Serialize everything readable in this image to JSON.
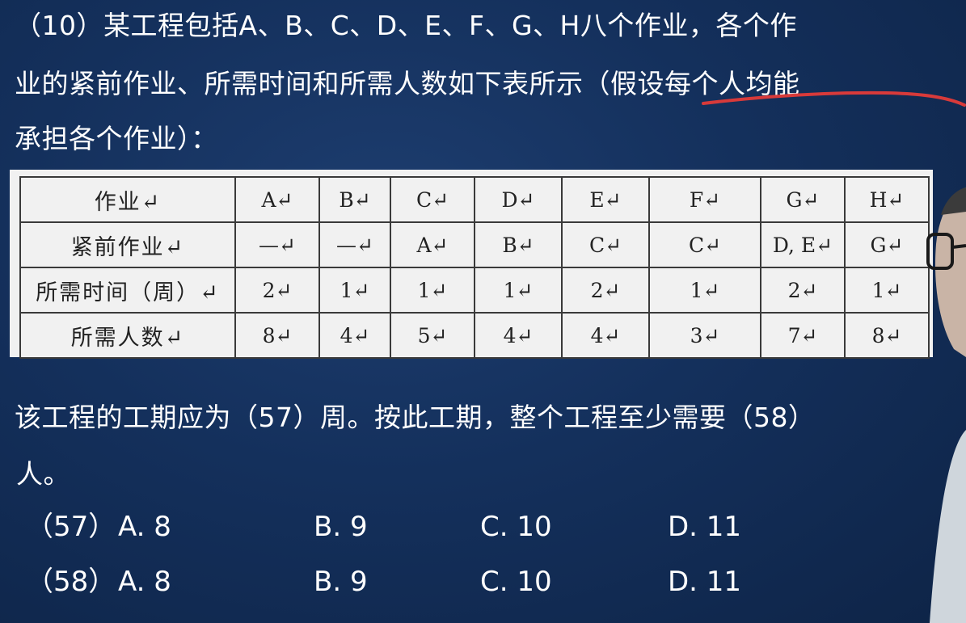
{
  "question": {
    "line1": "（10）某工程包括A、B、C、D、E、F、G、H八个作业，各个作",
    "line2": "业的紧前作业、所需时间和所需人数如下表所示（假设每个人均能",
    "line3": "承担各个作业）：",
    "line4": "该工程的工期应为（57）周。按此工期，整个工程至少需要（58）",
    "line5": "人。"
  },
  "table": {
    "header_label": "作业↵",
    "columns": [
      "A↵",
      "B↵",
      "C↵",
      "D↵",
      "E↵",
      "F↵",
      "G↵",
      "H↵"
    ],
    "rows": [
      {
        "label": "紧前作业↵",
        "values": [
          "—↵",
          "—↵",
          "A↵",
          "B↵",
          "C↵",
          "C↵",
          "D, E↵",
          "G↵"
        ]
      },
      {
        "label": "所需时间（周）↵",
        "values": [
          "2↵",
          "1↵",
          "1↵",
          "1↵",
          "2↵",
          "1↵",
          "2↵",
          "1↵"
        ]
      },
      {
        "label": "所需人数↵",
        "values": [
          "8↵",
          "4↵",
          "5↵",
          "4↵",
          "4↵",
          "3↵",
          "7↵",
          "8↵"
        ]
      }
    ]
  },
  "options": [
    {
      "number": "（57）",
      "a": "A. 8",
      "b": "B. 9",
      "c": "C. 10",
      "d": "D. 11"
    },
    {
      "number": "（58）",
      "a": "A. 8",
      "b": "B. 9",
      "c": "C. 10",
      "d": "D. 11"
    }
  ],
  "colors": {
    "background": "#14305c",
    "text": "#ffffff",
    "table_bg": "#f1f1f1",
    "table_text": "#222222",
    "annotation": "#d83a3a"
  }
}
